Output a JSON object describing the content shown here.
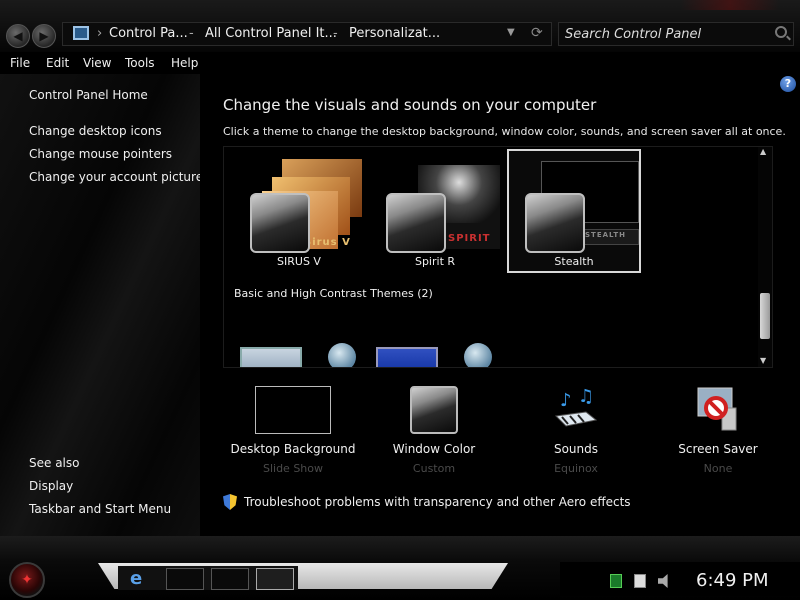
{
  "window": {
    "breadcrumb": [
      "Control Pa...",
      "All Control Panel It...",
      "Personalizat..."
    ],
    "search_placeholder": "Search Control Panel"
  },
  "menu": [
    "File",
    "Edit",
    "View",
    "Tools",
    "Help"
  ],
  "sidebar": {
    "home": "Control Panel Home",
    "links": [
      "Change desktop icons",
      "Change mouse pointers",
      "Change your account picture"
    ],
    "see_also_title": "See also",
    "see_also": [
      "Display",
      "Taskbar and Start Menu"
    ]
  },
  "main": {
    "title": "Change the visuals and sounds on your computer",
    "subtitle": "Click a theme to change the desktop background, window color, sounds, and screen saver all at once.",
    "themes": [
      {
        "name": "SIRUS V",
        "brand": "Sirus V",
        "selected": false
      },
      {
        "name": "Spirit R",
        "brand": "SPIRIT",
        "selected": false
      },
      {
        "name": "Stealth",
        "brand": "STEALTH",
        "selected": true
      }
    ],
    "basic_header": "Basic and High Contrast Themes (2)",
    "bottom_items": [
      {
        "label": "Desktop Background",
        "sub": "Slide Show",
        "icon": "desktop-background-icon"
      },
      {
        "label": "Window Color",
        "sub": "Custom",
        "icon": "window-color-icon"
      },
      {
        "label": "Sounds",
        "sub": "Equinox",
        "icon": "sounds-icon"
      },
      {
        "label": "Screen Saver",
        "sub": "None",
        "icon": "screen-saver-icon"
      }
    ],
    "troubleshoot": "Troubleshoot problems with transparency and other Aero effects"
  },
  "taskbar": {
    "clock": "6:49 PM"
  }
}
